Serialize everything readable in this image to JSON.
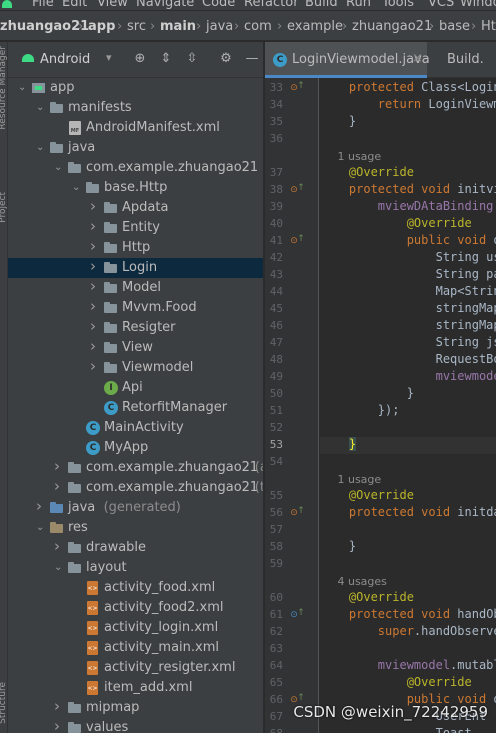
{
  "menubar": {
    "items": [
      "File",
      "Edit",
      "View",
      "Navigate",
      "Code",
      "Refactor",
      "Build",
      "Run",
      "Tools",
      "VCS",
      "Window"
    ]
  },
  "breadcrumb": [
    "zhuangao21",
    "app",
    "src",
    "main",
    "java",
    "com",
    "example",
    "zhuangao21",
    "base",
    "Http"
  ],
  "project_panel": {
    "view_label": "Android",
    "tree": [
      {
        "label": "app",
        "level": 0,
        "arrow": "down",
        "icon": "module-icon"
      },
      {
        "label": "manifests",
        "level": 1,
        "arrow": "down",
        "icon": "folder-icon"
      },
      {
        "label": "AndroidManifest.xml",
        "level": 2,
        "arrow": "",
        "icon": "manifest-icon"
      },
      {
        "label": "java",
        "level": 1,
        "arrow": "down",
        "icon": "folder-icon"
      },
      {
        "label": "com.example.zhuangao21",
        "level": 2,
        "arrow": "down",
        "icon": "package-icon"
      },
      {
        "label": "base.Http",
        "level": 3,
        "arrow": "down",
        "icon": "package-icon"
      },
      {
        "label": "Apdata",
        "level": 4,
        "arrow": "right",
        "icon": "package-icon"
      },
      {
        "label": "Entity",
        "level": 4,
        "arrow": "right",
        "icon": "package-icon"
      },
      {
        "label": "Http",
        "level": 4,
        "arrow": "right",
        "icon": "package-icon"
      },
      {
        "label": "Login",
        "level": 4,
        "arrow": "right",
        "icon": "package-icon",
        "selected": true
      },
      {
        "label": "Model",
        "level": 4,
        "arrow": "right",
        "icon": "package-icon"
      },
      {
        "label": "Mvvm.Food",
        "level": 4,
        "arrow": "right",
        "icon": "package-icon"
      },
      {
        "label": "Resigter",
        "level": 4,
        "arrow": "right",
        "icon": "package-icon"
      },
      {
        "label": "View",
        "level": 4,
        "arrow": "right",
        "icon": "package-icon"
      },
      {
        "label": "Viewmodel",
        "level": 4,
        "arrow": "right",
        "icon": "package-icon"
      },
      {
        "label": "Api",
        "level": 4,
        "arrow": "",
        "icon": "interface-icon"
      },
      {
        "label": "RetorfitManager",
        "level": 4,
        "arrow": "",
        "icon": "class-icon"
      },
      {
        "label": "MainActivity",
        "level": 3,
        "arrow": "",
        "icon": "class-icon"
      },
      {
        "label": "MyApp",
        "level": 3,
        "arrow": "",
        "icon": "class-icon"
      },
      {
        "label": "com.example.zhuangao21",
        "suffix": "(and",
        "level": 2,
        "arrow": "right",
        "icon": "package-icon"
      },
      {
        "label": "com.example.zhuangao21",
        "suffix": "(test",
        "level": 2,
        "arrow": "right",
        "icon": "package-icon"
      },
      {
        "label": "java",
        "suffix": "(generated)",
        "level": 1,
        "arrow": "right",
        "icon": "source-folder-icon"
      },
      {
        "label": "res",
        "level": 1,
        "arrow": "down",
        "icon": "res-folder-icon"
      },
      {
        "label": "drawable",
        "level": 2,
        "arrow": "right",
        "icon": "folder-icon"
      },
      {
        "label": "layout",
        "level": 2,
        "arrow": "down",
        "icon": "folder-icon"
      },
      {
        "label": "activity_food.xml",
        "level": 3,
        "arrow": "",
        "icon": "layout-xml-icon"
      },
      {
        "label": "activity_food2.xml",
        "level": 3,
        "arrow": "",
        "icon": "layout-xml-icon"
      },
      {
        "label": "activity_login.xml",
        "level": 3,
        "arrow": "",
        "icon": "layout-xml-icon"
      },
      {
        "label": "activity_main.xml",
        "level": 3,
        "arrow": "",
        "icon": "layout-xml-icon"
      },
      {
        "label": "activity_resigter.xml",
        "level": 3,
        "arrow": "",
        "icon": "layout-xml-icon"
      },
      {
        "label": "item_add.xml",
        "level": 3,
        "arrow": "",
        "icon": "layout-xml-icon"
      },
      {
        "label": "mipmap",
        "level": 2,
        "arrow": "right",
        "icon": "folder-icon"
      },
      {
        "label": "values",
        "level": 2,
        "arrow": "right",
        "icon": "folder-icon"
      }
    ]
  },
  "editor": {
    "tabs": [
      {
        "label": "LoginViewmodel.java",
        "active": true
      },
      {
        "label": "Build.",
        "active": false
      }
    ],
    "current_line": 53,
    "lines": [
      {
        "n": 33,
        "m": "impl",
        "t": "    protected Class<Login"
      },
      {
        "n": 34,
        "m": "",
        "t": "        return LoginViewm"
      },
      {
        "n": 35,
        "m": "",
        "t": "    }"
      },
      {
        "n": 36,
        "m": "",
        "t": ""
      },
      {
        "n": null,
        "hint": "1 usage"
      },
      {
        "n": 37,
        "m": "",
        "t": "    @Override"
      },
      {
        "n": 38,
        "m": "impl",
        "t": "    protected void initvi"
      },
      {
        "n": 39,
        "m": "",
        "t": "        mviewDAtaBinding."
      },
      {
        "n": 40,
        "m": "",
        "t": "            @Override"
      },
      {
        "n": 41,
        "m": "impl",
        "t": "            public void o"
      },
      {
        "n": 42,
        "m": "",
        "t": "                String us"
      },
      {
        "n": 43,
        "m": "",
        "t": "                String pa"
      },
      {
        "n": 44,
        "m": "",
        "t": "                Map<Strin"
      },
      {
        "n": 45,
        "m": "",
        "t": "                stringMap"
      },
      {
        "n": 46,
        "m": "",
        "t": "                stringMap"
      },
      {
        "n": 47,
        "m": "",
        "t": "                String js"
      },
      {
        "n": 48,
        "m": "",
        "t": "                RequestBo"
      },
      {
        "n": 49,
        "m": "",
        "t": "                mviewmode"
      },
      {
        "n": 50,
        "m": "",
        "t": "            }"
      },
      {
        "n": 51,
        "m": "",
        "t": "        });"
      },
      {
        "n": 52,
        "m": "",
        "t": ""
      },
      {
        "n": 53,
        "m": "",
        "t": "    }"
      },
      {
        "n": 54,
        "m": "",
        "t": ""
      },
      {
        "n": null,
        "hint": "1 usage"
      },
      {
        "n": 55,
        "m": "",
        "t": "    @Override"
      },
      {
        "n": 56,
        "m": "impl",
        "t": "    protected void initda"
      },
      {
        "n": 57,
        "m": "",
        "t": ""
      },
      {
        "n": 58,
        "m": "",
        "t": "    }"
      },
      {
        "n": 59,
        "m": "",
        "t": ""
      },
      {
        "n": null,
        "hint": "4 usages"
      },
      {
        "n": 60,
        "m": "",
        "t": "    @Override"
      },
      {
        "n": 61,
        "m": "ovr",
        "t": "    protected void handOb"
      },
      {
        "n": 62,
        "m": "",
        "t": "        super.handObserve"
      },
      {
        "n": 63,
        "m": "",
        "t": ""
      },
      {
        "n": 64,
        "m": "",
        "t": "        mviewmodel.mutabl"
      },
      {
        "n": 65,
        "m": "",
        "t": "            @Override"
      },
      {
        "n": 66,
        "m": "impl",
        "t": "            public void o"
      },
      {
        "n": 67,
        "m": "",
        "t": "                UserEnt"
      },
      {
        "n": 68,
        "m": "",
        "t": "                Toast"
      }
    ]
  },
  "watermark": "CSDN @weixin_72242959"
}
